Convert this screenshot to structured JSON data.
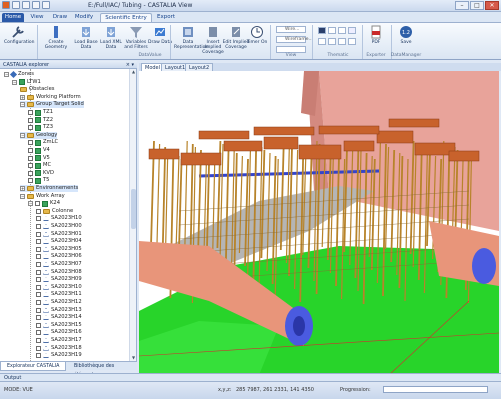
{
  "window": {
    "title": "E:/Full/IAC/ Tubing - CASTALIA View",
    "minimize": "–",
    "maximize": "□",
    "close": "✕"
  },
  "tabs": [
    "Home",
    "View",
    "Draw",
    "Modify",
    "Scientific Entry",
    "Export"
  ],
  "file_tab": "Home",
  "ribbon": {
    "buttons": [
      {
        "label": "Configuration",
        "icon": "wrench-icon"
      },
      {
        "label": "Create Geometry",
        "icon": "create-geometry-icon"
      },
      {
        "label": "Load Base Data",
        "icon": "load-base-icon"
      },
      {
        "label": "Load XML Data",
        "icon": "load-xml-icon"
      },
      {
        "label": "Variables and Filters",
        "icon": "filter-icon"
      },
      {
        "label": "Draw Data",
        "icon": "draw-data-icon"
      },
      {
        "label": "Data Representation",
        "icon": "data-representation-icon"
      },
      {
        "label": "Insert Implied Coverage",
        "icon": "insert-icon"
      },
      {
        "label": "Edit Implied Coverage",
        "icon": "edit-icon"
      },
      {
        "label": "Timer On",
        "icon": "timer-icon"
      },
      {
        "label": "PDF",
        "icon": "pdf-icon"
      },
      {
        "label": "Save",
        "icon": "save-icon"
      }
    ],
    "groups": [
      "DataValue",
      "View",
      "Thematic",
      "Exporter",
      "DataManager"
    ],
    "combos": [
      "Wire...",
      "Wireframe..."
    ]
  },
  "explorer": {
    "title": "CASTALIA explorer",
    "pin": "× ▾",
    "nodes": [
      {
        "label": "Zones",
        "depth": 0,
        "kind": "diamond",
        "exp": "−"
      },
      {
        "label": "LTW1",
        "depth": 1,
        "kind": "box",
        "exp": "−"
      },
      {
        "label": "Obstacles",
        "depth": 2,
        "kind": "folder",
        "exp": ""
      },
      {
        "label": "Working Platform",
        "depth": 2,
        "kind": "folder",
        "exp": "+"
      },
      {
        "label": "Group Target Solid",
        "depth": 2,
        "kind": "folder",
        "exp": "−",
        "highlight": true
      },
      {
        "label": "TZ1",
        "depth": 3,
        "kind": "green",
        "exp": ""
      },
      {
        "label": "TZ2",
        "depth": 3,
        "kind": "green",
        "exp": ""
      },
      {
        "label": "TZ3",
        "depth": 3,
        "kind": "green",
        "exp": ""
      },
      {
        "label": "Geology",
        "depth": 2,
        "kind": "folder",
        "exp": "−",
        "highlight": true
      },
      {
        "label": "ZmLC",
        "depth": 3,
        "kind": "green",
        "exp": ""
      },
      {
        "label": "V4",
        "depth": 3,
        "kind": "green",
        "exp": ""
      },
      {
        "label": "V5",
        "depth": 3,
        "kind": "green",
        "exp": ""
      },
      {
        "label": "MC",
        "depth": 3,
        "kind": "green",
        "exp": ""
      },
      {
        "label": "KVD",
        "depth": 3,
        "kind": "green",
        "exp": ""
      },
      {
        "label": "T5",
        "depth": 3,
        "kind": "green",
        "exp": ""
      },
      {
        "label": "Environnements",
        "depth": 2,
        "kind": "folder",
        "exp": "+",
        "highlight": true
      },
      {
        "label": "Work Array",
        "depth": 2,
        "kind": "folder",
        "exp": "−"
      },
      {
        "label": "K24",
        "depth": 3,
        "kind": "box",
        "exp": "−"
      },
      {
        "label": "Colonne",
        "depth": 4,
        "kind": "folder",
        "exp": ""
      },
      {
        "label": "SA2023H10",
        "depth": 4,
        "kind": "tri",
        "exp": ""
      },
      {
        "label": "SA2023H00",
        "depth": 4,
        "kind": "tri",
        "exp": ""
      },
      {
        "label": "SA2023H01",
        "depth": 4,
        "kind": "tri",
        "exp": ""
      },
      {
        "label": "SA2023H04",
        "depth": 4,
        "kind": "tri",
        "exp": ""
      },
      {
        "label": "SA2023H05",
        "depth": 4,
        "kind": "tri",
        "exp": ""
      },
      {
        "label": "SA2023H06",
        "depth": 4,
        "kind": "tri",
        "exp": ""
      },
      {
        "label": "SA2023H07",
        "depth": 4,
        "kind": "tri",
        "exp": ""
      },
      {
        "label": "SA2023H08",
        "depth": 4,
        "kind": "tri",
        "exp": ""
      },
      {
        "label": "SA2023H09",
        "depth": 4,
        "kind": "tri",
        "exp": ""
      },
      {
        "label": "SA2023H10",
        "depth": 4,
        "kind": "tri",
        "exp": ""
      },
      {
        "label": "SA2023H11",
        "depth": 4,
        "kind": "tri",
        "exp": ""
      },
      {
        "label": "SA2023H12",
        "depth": 4,
        "kind": "tri",
        "exp": ""
      },
      {
        "label": "SA2023H13",
        "depth": 4,
        "kind": "tri",
        "exp": ""
      },
      {
        "label": "SA2023H14",
        "depth": 4,
        "kind": "tri",
        "exp": ""
      },
      {
        "label": "SA2023H15",
        "depth": 4,
        "kind": "tri",
        "exp": ""
      },
      {
        "label": "SA2023H16",
        "depth": 4,
        "kind": "tri",
        "exp": ""
      },
      {
        "label": "SA2023H17",
        "depth": 4,
        "kind": "tri",
        "exp": ""
      },
      {
        "label": "SA2023H18",
        "depth": 4,
        "kind": "tri",
        "exp": ""
      },
      {
        "label": "SA2023H19",
        "depth": 4,
        "kind": "tri",
        "exp": ""
      }
    ],
    "bottom_tabs": [
      "Explorateur CASTALIA",
      "Bibliothèque des éléments"
    ]
  },
  "viewport": {
    "tabs": [
      "Model",
      "Layout1",
      "Layout2"
    ]
  },
  "output_label": "Output",
  "status": {
    "mode": "MODE: VUE",
    "xyz_label": "x,y,z:",
    "xyz_value": "285 7987, 261 2331, 141 4350",
    "progress_label": "Progression:",
    "progress": 0.0
  },
  "colors": {
    "sky": "#ffffff",
    "ground": "#28d42a",
    "building": "#e8a39a",
    "piles": "#b7832a",
    "caps": "#c8622c",
    "tunnel": "#e8957a",
    "tunnel_end": "#4a5be0"
  }
}
